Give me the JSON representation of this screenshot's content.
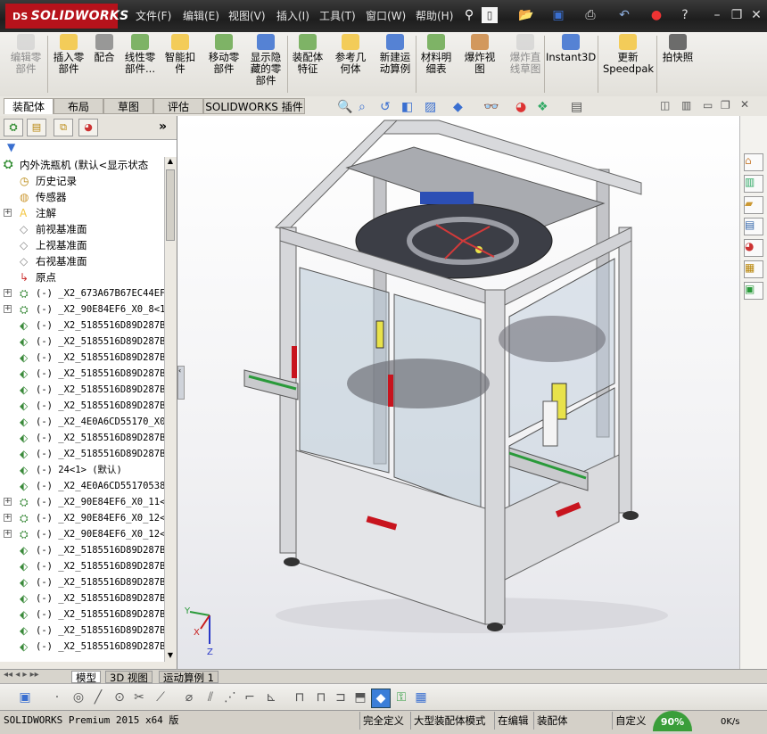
{
  "titlebar": {
    "logo": "SOLIDWORKS",
    "logo_prefix": "DS",
    "menus": [
      "文件(F)",
      "编辑(E)",
      "视图(V)",
      "插入(I)",
      "工具(T)",
      "窗口(W)",
      "帮助(H)"
    ]
  },
  "command_manager": {
    "buttons": [
      {
        "label": "编辑零\n部件",
        "enabled": false,
        "icon": "edit-component-icon"
      },
      {
        "label": "插入零\n部件",
        "enabled": true,
        "icon": "insert-components-icon"
      },
      {
        "label": "配合",
        "enabled": true,
        "icon": "mate-icon"
      },
      {
        "label": "线性零\n部件...",
        "enabled": true,
        "icon": "linear-pattern-icon"
      },
      {
        "label": "智能扣\n件",
        "enabled": true,
        "icon": "smart-fasteners-icon"
      },
      {
        "label": "移动零\n部件",
        "enabled": true,
        "icon": "move-component-icon"
      },
      {
        "label": "显示隐\n藏的零\n部件",
        "enabled": true,
        "icon": "show-hidden-icon"
      },
      {
        "label": "装配体\n特征",
        "enabled": true,
        "icon": "assembly-features-icon"
      },
      {
        "label": "参考几\n何体",
        "enabled": true,
        "icon": "reference-geometry-icon"
      },
      {
        "label": "新建运\n动算例",
        "enabled": true,
        "icon": "new-motion-study-icon"
      },
      {
        "label": "材料明\n细表",
        "enabled": true,
        "icon": "bill-of-materials-icon"
      },
      {
        "label": "爆炸视\n图",
        "enabled": true,
        "icon": "exploded-view-icon"
      },
      {
        "label": "爆炸直\n线草图",
        "enabled": false,
        "icon": "explode-line-sketch-icon"
      },
      {
        "label": "Instant3D",
        "enabled": true,
        "icon": "instant3d-icon"
      },
      {
        "label": "更新\nSpeedpak",
        "enabled": true,
        "icon": "speedpak-icon"
      },
      {
        "label": "拍快照",
        "enabled": true,
        "icon": "snapshot-icon"
      }
    ]
  },
  "tabs": [
    "装配体",
    "布局",
    "草图",
    "评估",
    "SOLIDWORKS 插件"
  ],
  "active_tab": "装配体",
  "feature_tree": {
    "root": "内外洗瓶机  (默认<显示状态",
    "items": [
      {
        "label": "历史记录",
        "expand": false,
        "icon": "history-icon"
      },
      {
        "label": "传感器",
        "expand": false,
        "icon": "sensor-icon"
      },
      {
        "label": "注解",
        "expand": true,
        "icon": "annotation-icon"
      },
      {
        "label": "前视基准面",
        "expand": false,
        "icon": "plane-icon"
      },
      {
        "label": "上视基准面",
        "expand": false,
        "icon": "plane-icon"
      },
      {
        "label": "右视基准面",
        "expand": false,
        "icon": "plane-icon"
      },
      {
        "label": "原点",
        "expand": false,
        "icon": "origin-icon"
      },
      {
        "label": "(-) _X2_673A67B67EC44EF",
        "expand": true,
        "icon": "subassembly-icon"
      },
      {
        "label": "(-) _X2_90E84EF6_X0_8<1",
        "expand": true,
        "icon": "subassembly-icon"
      },
      {
        "label": "(-) _X2_5185516D89D287B",
        "expand": false,
        "icon": "part-icon"
      },
      {
        "label": "(-) _X2_5185516D89D287B",
        "expand": false,
        "icon": "part-icon"
      },
      {
        "label": "(-) _X2_5185516D89D287B",
        "expand": false,
        "icon": "part-icon"
      },
      {
        "label": "(-) _X2_5185516D89D287B",
        "expand": false,
        "icon": "part-icon"
      },
      {
        "label": "(-) _X2_5185516D89D287B",
        "expand": false,
        "icon": "part-icon"
      },
      {
        "label": "(-) _X2_5185516D89D287B",
        "expand": false,
        "icon": "part-icon"
      },
      {
        "label": "(-) _X2_4E0A6CD55170_X0",
        "expand": false,
        "icon": "part-icon"
      },
      {
        "label": "(-) _X2_5185516D89D287B",
        "expand": false,
        "icon": "part-icon"
      },
      {
        "label": "(-) _X2_5185516D89D287B",
        "expand": false,
        "icon": "part-icon"
      },
      {
        "label": "(-) 24<1> (默认)",
        "expand": false,
        "icon": "part-icon"
      },
      {
        "label": "(-) _X2_4E0A6CD55170538",
        "expand": false,
        "icon": "part-icon"
      },
      {
        "label": "(-) _X2_90E84EF6_X0_11<",
        "expand": true,
        "icon": "subassembly-icon"
      },
      {
        "label": "(-) _X2_90E84EF6_X0_12<",
        "expand": true,
        "icon": "subassembly-icon"
      },
      {
        "label": "(-) _X2_90E84EF6_X0_12<",
        "expand": true,
        "icon": "subassembly-icon"
      },
      {
        "label": "(-) _X2_5185516D89D287B",
        "expand": false,
        "icon": "part-icon"
      },
      {
        "label": "(-) _X2_5185516D89D287B",
        "expand": false,
        "icon": "part-icon"
      },
      {
        "label": "(-) _X2_5185516D89D287B",
        "expand": false,
        "icon": "part-icon"
      },
      {
        "label": "(-) _X2_5185516D89D287B",
        "expand": false,
        "icon": "part-icon"
      },
      {
        "label": "(-) _X2_5185516D89D287B",
        "expand": false,
        "icon": "part-icon"
      },
      {
        "label": "(-) _X2_5185516D89D287B",
        "expand": false,
        "icon": "part-icon"
      },
      {
        "label": "(-) _X2_5185516D89D287B",
        "expand": false,
        "icon": "part-icon"
      }
    ]
  },
  "triad": {
    "x": "X",
    "y": "Y",
    "z": "Z"
  },
  "bottom_tabs": [
    "模型",
    "3D 视图",
    "运动算例 1"
  ],
  "active_bottom_tab": "模型",
  "statusbar": {
    "product": "SOLIDWORKS Premium 2015 x64 版",
    "defined": "完全定义",
    "mode": "大型装配体模式",
    "editing": "在编辑",
    "doc": "装配体",
    "custom": "自定义",
    "zoom": "90%",
    "net": "0K/s"
  },
  "colors": {
    "brand": "#b6121b",
    "handle": "#c8141e",
    "frame": "#cfcfd2",
    "glass": "#b8c8d6"
  }
}
